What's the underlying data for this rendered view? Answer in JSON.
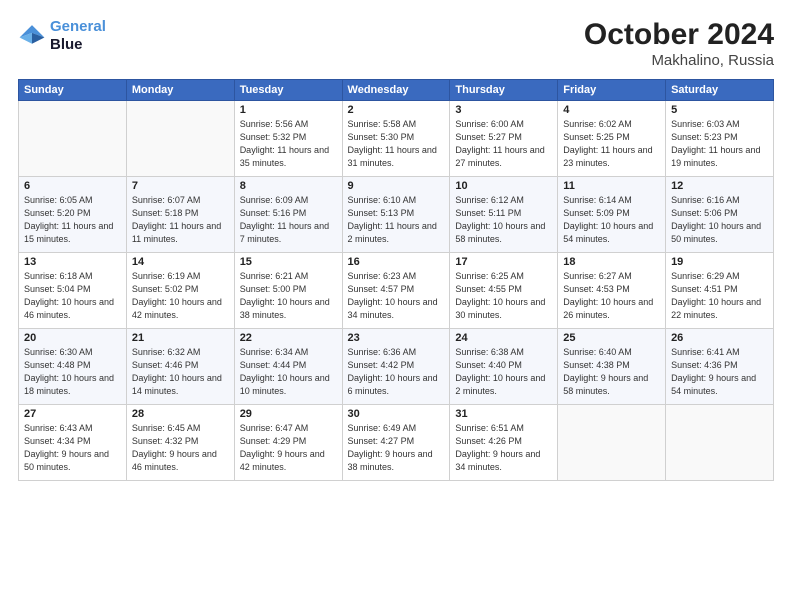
{
  "header": {
    "logo_line1": "General",
    "logo_line2": "Blue",
    "month": "October 2024",
    "location": "Makhalino, Russia"
  },
  "days_of_week": [
    "Sunday",
    "Monday",
    "Tuesday",
    "Wednesday",
    "Thursday",
    "Friday",
    "Saturday"
  ],
  "weeks": [
    [
      {
        "day": "",
        "info": ""
      },
      {
        "day": "",
        "info": ""
      },
      {
        "day": "1",
        "info": "Sunrise: 5:56 AM\nSunset: 5:32 PM\nDaylight: 11 hours and 35 minutes."
      },
      {
        "day": "2",
        "info": "Sunrise: 5:58 AM\nSunset: 5:30 PM\nDaylight: 11 hours and 31 minutes."
      },
      {
        "day": "3",
        "info": "Sunrise: 6:00 AM\nSunset: 5:27 PM\nDaylight: 11 hours and 27 minutes."
      },
      {
        "day": "4",
        "info": "Sunrise: 6:02 AM\nSunset: 5:25 PM\nDaylight: 11 hours and 23 minutes."
      },
      {
        "day": "5",
        "info": "Sunrise: 6:03 AM\nSunset: 5:23 PM\nDaylight: 11 hours and 19 minutes."
      }
    ],
    [
      {
        "day": "6",
        "info": "Sunrise: 6:05 AM\nSunset: 5:20 PM\nDaylight: 11 hours and 15 minutes."
      },
      {
        "day": "7",
        "info": "Sunrise: 6:07 AM\nSunset: 5:18 PM\nDaylight: 11 hours and 11 minutes."
      },
      {
        "day": "8",
        "info": "Sunrise: 6:09 AM\nSunset: 5:16 PM\nDaylight: 11 hours and 7 minutes."
      },
      {
        "day": "9",
        "info": "Sunrise: 6:10 AM\nSunset: 5:13 PM\nDaylight: 11 hours and 2 minutes."
      },
      {
        "day": "10",
        "info": "Sunrise: 6:12 AM\nSunset: 5:11 PM\nDaylight: 10 hours and 58 minutes."
      },
      {
        "day": "11",
        "info": "Sunrise: 6:14 AM\nSunset: 5:09 PM\nDaylight: 10 hours and 54 minutes."
      },
      {
        "day": "12",
        "info": "Sunrise: 6:16 AM\nSunset: 5:06 PM\nDaylight: 10 hours and 50 minutes."
      }
    ],
    [
      {
        "day": "13",
        "info": "Sunrise: 6:18 AM\nSunset: 5:04 PM\nDaylight: 10 hours and 46 minutes."
      },
      {
        "day": "14",
        "info": "Sunrise: 6:19 AM\nSunset: 5:02 PM\nDaylight: 10 hours and 42 minutes."
      },
      {
        "day": "15",
        "info": "Sunrise: 6:21 AM\nSunset: 5:00 PM\nDaylight: 10 hours and 38 minutes."
      },
      {
        "day": "16",
        "info": "Sunrise: 6:23 AM\nSunset: 4:57 PM\nDaylight: 10 hours and 34 minutes."
      },
      {
        "day": "17",
        "info": "Sunrise: 6:25 AM\nSunset: 4:55 PM\nDaylight: 10 hours and 30 minutes."
      },
      {
        "day": "18",
        "info": "Sunrise: 6:27 AM\nSunset: 4:53 PM\nDaylight: 10 hours and 26 minutes."
      },
      {
        "day": "19",
        "info": "Sunrise: 6:29 AM\nSunset: 4:51 PM\nDaylight: 10 hours and 22 minutes."
      }
    ],
    [
      {
        "day": "20",
        "info": "Sunrise: 6:30 AM\nSunset: 4:48 PM\nDaylight: 10 hours and 18 minutes."
      },
      {
        "day": "21",
        "info": "Sunrise: 6:32 AM\nSunset: 4:46 PM\nDaylight: 10 hours and 14 minutes."
      },
      {
        "day": "22",
        "info": "Sunrise: 6:34 AM\nSunset: 4:44 PM\nDaylight: 10 hours and 10 minutes."
      },
      {
        "day": "23",
        "info": "Sunrise: 6:36 AM\nSunset: 4:42 PM\nDaylight: 10 hours and 6 minutes."
      },
      {
        "day": "24",
        "info": "Sunrise: 6:38 AM\nSunset: 4:40 PM\nDaylight: 10 hours and 2 minutes."
      },
      {
        "day": "25",
        "info": "Sunrise: 6:40 AM\nSunset: 4:38 PM\nDaylight: 9 hours and 58 minutes."
      },
      {
        "day": "26",
        "info": "Sunrise: 6:41 AM\nSunset: 4:36 PM\nDaylight: 9 hours and 54 minutes."
      }
    ],
    [
      {
        "day": "27",
        "info": "Sunrise: 6:43 AM\nSunset: 4:34 PM\nDaylight: 9 hours and 50 minutes."
      },
      {
        "day": "28",
        "info": "Sunrise: 6:45 AM\nSunset: 4:32 PM\nDaylight: 9 hours and 46 minutes."
      },
      {
        "day": "29",
        "info": "Sunrise: 6:47 AM\nSunset: 4:29 PM\nDaylight: 9 hours and 42 minutes."
      },
      {
        "day": "30",
        "info": "Sunrise: 6:49 AM\nSunset: 4:27 PM\nDaylight: 9 hours and 38 minutes."
      },
      {
        "day": "31",
        "info": "Sunrise: 6:51 AM\nSunset: 4:26 PM\nDaylight: 9 hours and 34 minutes."
      },
      {
        "day": "",
        "info": ""
      },
      {
        "day": "",
        "info": ""
      }
    ]
  ]
}
